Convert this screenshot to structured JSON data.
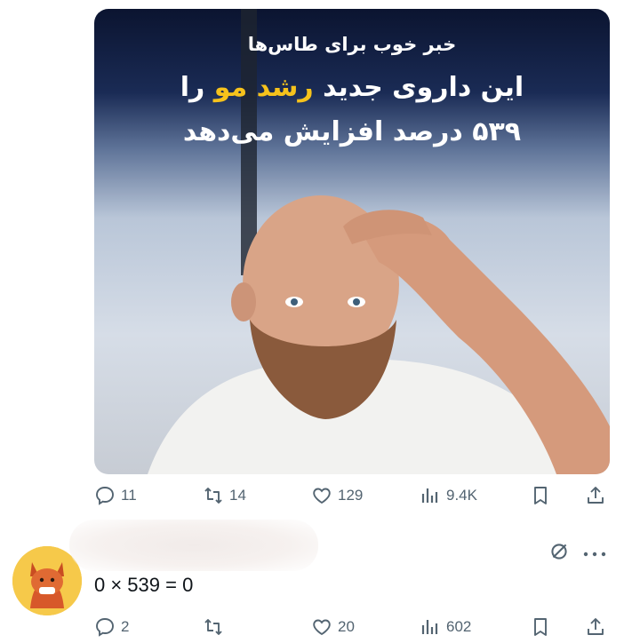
{
  "post": {
    "image": {
      "headline_line1": "خبر خوب برای طاس‌ها",
      "headline_line2_prefix": "این داروی جدید ",
      "headline_line2_highlight": "رشد مو",
      "headline_line2_suffix": " را",
      "headline_line3": "۵۳۹ درصد افزایش می‌دهد",
      "highlight_color": "#f6c21c"
    },
    "actions": {
      "replies": "11",
      "reposts": "14",
      "likes": "129",
      "views": "9.4K"
    }
  },
  "reply": {
    "text": "0 × 539 = 0",
    "actions": {
      "replies": "2",
      "reposts": "",
      "likes": "20",
      "views": "602"
    }
  },
  "icons": {
    "reply": "comment-icon",
    "repost": "repost-icon",
    "like": "heart-icon",
    "views": "analytics-icon",
    "bookmark": "bookmark-icon",
    "share": "share-icon",
    "more": "more-icon",
    "grok": "grok-icon"
  },
  "colors": {
    "icon_gray": "#536471",
    "text": "#0f1419"
  }
}
